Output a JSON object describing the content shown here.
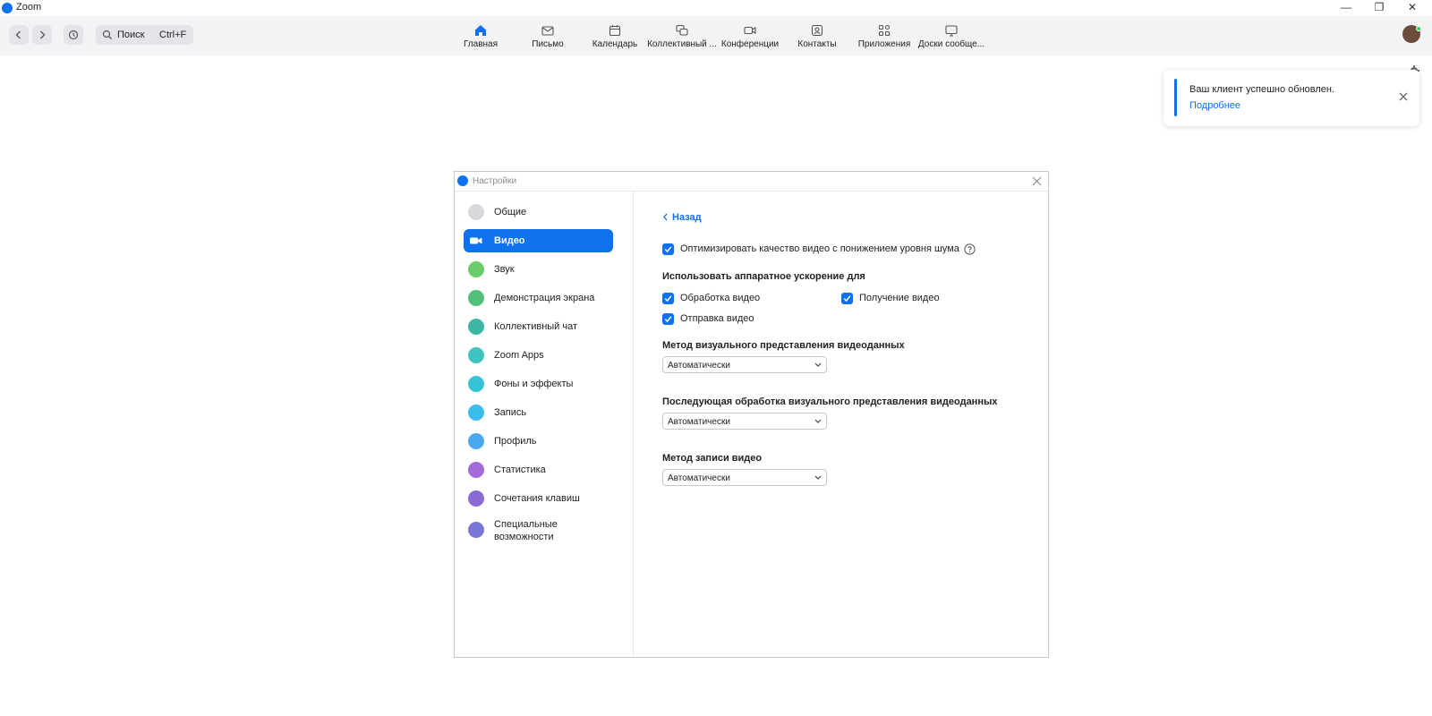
{
  "app": {
    "title": "Zoom"
  },
  "window_controls": {
    "minimize": "—",
    "restore": "❐",
    "close": "✕"
  },
  "search": {
    "label": "Поиск",
    "shortcut": "Ctrl+F"
  },
  "tabs": [
    {
      "label": "Главная",
      "icon": "home-icon"
    },
    {
      "label": "Письмо",
      "icon": "mail-icon"
    },
    {
      "label": "Календарь",
      "icon": "calendar-icon"
    },
    {
      "label": "Коллективный ...",
      "icon": "chat-icon"
    },
    {
      "label": "Конференции",
      "icon": "video-icon"
    },
    {
      "label": "Контакты",
      "icon": "contacts-icon"
    },
    {
      "label": "Приложения",
      "icon": "apps-icon"
    },
    {
      "label": "Доски сообще...",
      "icon": "whiteboard-icon"
    }
  ],
  "notification": {
    "message": "Ваш клиент успешно обновлен.",
    "link": "Подробнее"
  },
  "dialog": {
    "title": "Настройки",
    "sidebar": [
      {
        "label": "Общие",
        "icon": "general-icon",
        "color": "#d8d8dc"
      },
      {
        "label": "Видео",
        "icon": "video-icon",
        "color": "#0e72ed",
        "active": true
      },
      {
        "label": "Звук",
        "icon": "headphones-icon",
        "color": "#6ccc6c"
      },
      {
        "label": "Демонстрация экрана",
        "icon": "share-screen-icon",
        "color": "#52c07b"
      },
      {
        "label": "Коллективный чат",
        "icon": "chat-icon",
        "color": "#3eb6a4"
      },
      {
        "label": "Zoom Apps",
        "icon": "zoom-apps-icon",
        "color": "#3ec3c0"
      },
      {
        "label": "Фоны и эффекты",
        "icon": "backgrounds-icon",
        "color": "#37c3d6"
      },
      {
        "label": "Запись",
        "icon": "record-icon",
        "color": "#3cbcea"
      },
      {
        "label": "Профиль",
        "icon": "profile-icon",
        "color": "#4aa8ee"
      },
      {
        "label": "Статистика",
        "icon": "statistics-icon",
        "color": "#a26bd8"
      },
      {
        "label": "Сочетания клавиш",
        "icon": "keyboard-icon",
        "color": "#8a6ad4"
      },
      {
        "label": "Специальные возможности",
        "icon": "accessibility-icon",
        "color": "#7a76d8"
      }
    ],
    "content": {
      "back": "Назад",
      "optimize": {
        "label": "Оптимизировать качество видео с понижением уровня шума",
        "checked": true
      },
      "hw_accel_title": "Использовать аппаратное ускорение для",
      "hw_processing": {
        "label": "Обработка видео",
        "checked": true
      },
      "hw_receive": {
        "label": "Получение видео",
        "checked": true
      },
      "hw_send": {
        "label": "Отправка видео",
        "checked": true
      },
      "render_method_title": "Метод визуального представления видеоданных",
      "render_method_value": "Автоматически",
      "postproc_title": "Последующая обработка визуального представления видеоданных",
      "postproc_value": "Автоматически",
      "capture_title": "Метод записи видео",
      "capture_value": "Автоматически"
    }
  }
}
